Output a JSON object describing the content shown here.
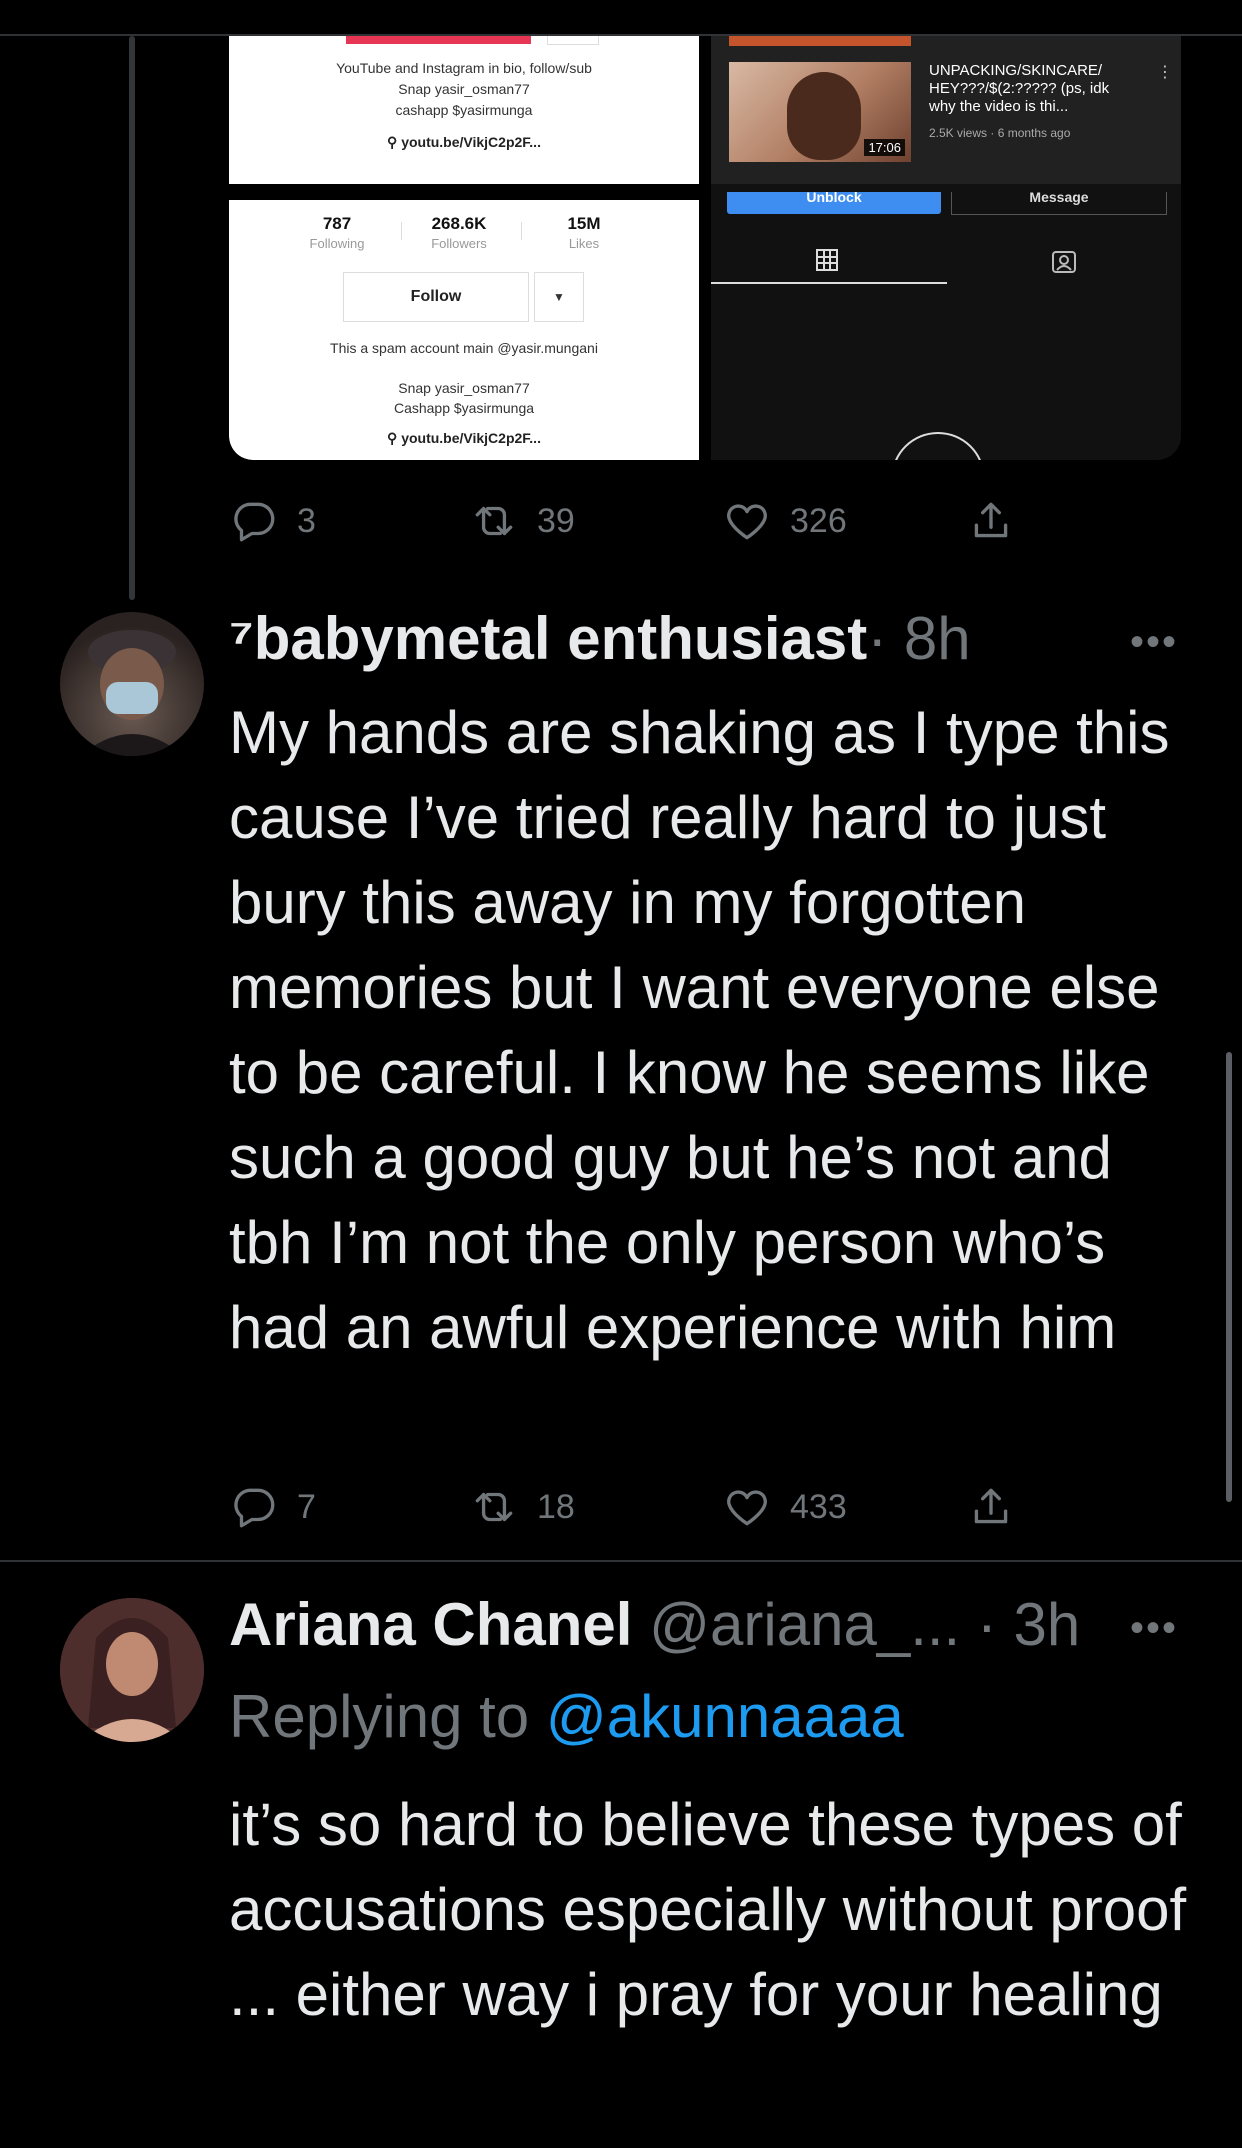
{
  "embedded_screenshot": {
    "tiktok_bio_top": {
      "line1": "YouTube and Instagram in bio, follow/sub",
      "line2": "Snap yasir_osman77",
      "line3": "cashapp $yasirmunga",
      "link": "youtu.be/VikjC2p2F..."
    },
    "tiktok_profile": {
      "following_count": "787",
      "following_label": "Following",
      "followers_count": "268.6K",
      "followers_label": "Followers",
      "likes_count": "15M",
      "likes_label": "Likes",
      "follow_button": "Follow",
      "bio_line1": "This a spam account main @yasir.mungani",
      "bio_line2": "Snap yasir_osman77",
      "bio_line3": "Cashapp $yasirmunga",
      "link": "youtu.be/VikjC2p2F..."
    },
    "youtube_video": {
      "title": "UNPACKING/SKINCARE/ HEY???/$(2:????? (ps, idk why the video is thi...",
      "meta": "2.5K views · 6 months ago",
      "duration": "17:06"
    },
    "youtube_buttons": {
      "unblock": "Unblock",
      "message": "Message"
    }
  },
  "quoted_tweet_actions": {
    "replies": "3",
    "retweets": "39",
    "likes": "326"
  },
  "tweet1": {
    "display_name": "⁷babymetal enthusiast",
    "time": "· 8h",
    "text": "My hands are shaking as I type this cause I’ve tried really hard to just bury this away in my forgotten memories but I want everyone else to be careful. I know he seems like such a good guy but he’s not and tbh I’m not the only person who’s had an awful experience with him",
    "replies": "7",
    "retweets": "18",
    "likes": "433"
  },
  "tweet2": {
    "display_name": "Ariana Chanel",
    "handle": "@ariana_...",
    "time": "· 3h",
    "replying_prefix": "Replying to",
    "replying_handle": "@akunnaaaa",
    "text": "it’s so hard to believe these types of accusations especially without proof ... either way i pray for your healing"
  },
  "more_glyph": "•••",
  "icons": [
    "reply-icon",
    "retweet-icon",
    "like-icon",
    "share-icon",
    "grid-icon",
    "profile-tag-icon",
    "link-icon",
    "more-icon"
  ]
}
